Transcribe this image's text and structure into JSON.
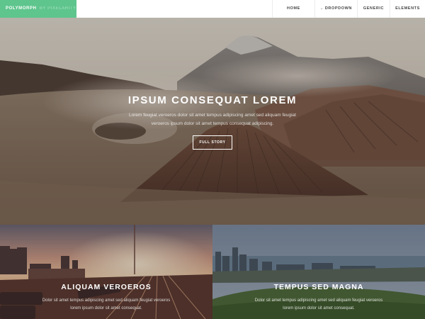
{
  "header": {
    "logo": {
      "name": "POLYMORPH",
      "byline": "BY PIXELARITY"
    },
    "nav": [
      {
        "label": "HOME",
        "dropdown": false
      },
      {
        "label": "DROPDOWN",
        "dropdown": true
      },
      {
        "label": "GENERIC",
        "dropdown": false
      },
      {
        "label": "ELEMENTS",
        "dropdown": false
      }
    ]
  },
  "banner": {
    "title": "IPSUM CONSEQUAT LOREM",
    "description": "Lorem feugiat veroeros dolor sit amet tempus adipiscing amet sed aliquam feugiat veroeros ipsum dolor sit amet tempus consequat adipiscing.",
    "button": "FULL STORY"
  },
  "tiles": [
    {
      "title": "ALIQUAM VEROEROS",
      "description": "Dolor sit amet tempus adipiscing amet sed aliquam feugiat veroeros lorem ipsum dolor sit amet consequat."
    },
    {
      "title": "TEMPUS SED MAGNA",
      "description": "Dolor sit amet tempus adipiscing amet sed aliquam feugiat veroeros lorem ipsum dolor sit amet consequat."
    }
  ],
  "colors": {
    "accent": "#5ec58d",
    "header_bg": "#ffffff",
    "nav_text": "#444444"
  },
  "icons": {
    "dropdown": "chevron-down-icon"
  }
}
